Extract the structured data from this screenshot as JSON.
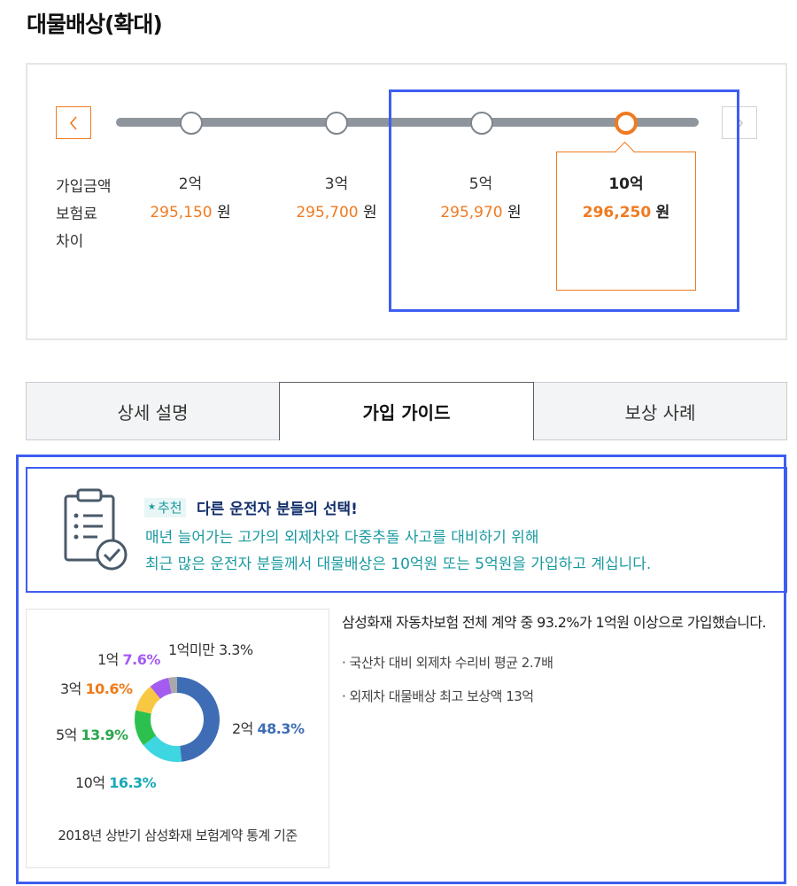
{
  "page_title": "대물배상(확대)",
  "selector": {
    "row_labels": [
      "가입금액",
      "보험료",
      "차이"
    ],
    "currency": "원",
    "options": [
      {
        "amount": "2억",
        "premium": "295,150",
        "selected": false
      },
      {
        "amount": "3억",
        "premium": "295,700",
        "selected": false
      },
      {
        "amount": "5억",
        "premium": "295,970",
        "selected": false
      },
      {
        "amount": "10억",
        "premium": "296,250",
        "selected": true
      }
    ],
    "prev_icon": "chevron-left-icon",
    "next_icon": "chevron-right-icon",
    "colors": {
      "accent": "#f07a21",
      "track": "#8e959c",
      "highlight": "#3d5ef0"
    }
  },
  "tabs": [
    {
      "label": "상세 설명",
      "active": false
    },
    {
      "label": "가입 가이드",
      "active": true
    },
    {
      "label": "보상 사례",
      "active": false
    }
  ],
  "guide": {
    "icon": "clipboard-check-icon",
    "tag": "추천",
    "tag_icon": "star-icon",
    "title": "다른 운전자 분들의 선택!",
    "lines": [
      "매년 늘어가는 고가의 외제차와 다중추돌 사고를 대비하기 위해",
      "최근 많은 운전자 분들께서 대물배상은 10억원 또는 5억원을 가입하고 계십니다."
    ],
    "colors": {
      "teal": "#1a9aa0",
      "navy": "#14306b"
    }
  },
  "donut": {
    "caption": "2018년 상반기 삼성화재 보험계약 통계 기준",
    "segments": [
      {
        "label": "2억",
        "value": "48.3%",
        "share": 48.3,
        "color": "#3e6db5"
      },
      {
        "label": "10억",
        "value": "16.3%",
        "share": 16.3,
        "color": "#3ed6e0"
      },
      {
        "label": "5억",
        "value": "13.9%",
        "share": 13.9,
        "color": "#2cc14f"
      },
      {
        "label": "3억",
        "value": "10.6%",
        "share": 10.6,
        "color": "#f9c842"
      },
      {
        "label": "1억",
        "value": "7.6%",
        "share": 7.6,
        "color": "#a45cf0"
      },
      {
        "label": "1억미만",
        "value": "3.3%",
        "share": 3.3,
        "color": "#a9a9a9"
      }
    ],
    "label_colors": [
      "#3e6db5",
      "#18a9b8",
      "#2aa64c",
      "#ef7b1a",
      "#a45cf0",
      "#444444"
    ]
  },
  "stats": {
    "main": "삼성화재 자동차보험 전체 계약 중 93.2%가 1억원 이상으로 가입했습니다.",
    "bullets": [
      "· 국산차 대비 외제차 수리비 평균 2.7배",
      "· 외제차 대물배상 최고 보상액 13억"
    ]
  }
}
